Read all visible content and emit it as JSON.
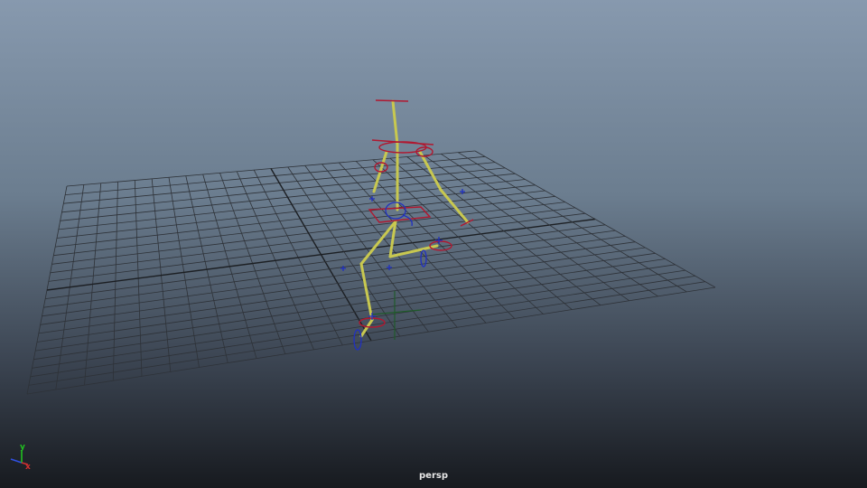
{
  "viewport": {
    "camera_name": "persp",
    "background_top": "#8799ae",
    "background_bottom": "#171a1f"
  },
  "axis_gizmo": {
    "x_label": "x",
    "y_label": "y",
    "x_color": "#d03030",
    "y_color": "#20c020",
    "z_color": "#3050e0"
  },
  "scene": {
    "grid_color": "#2e3238",
    "grid_axis_color": "#1c1f23",
    "bone_color": "#c8c850",
    "ik_control_color": "#b01830",
    "fk_control_color": "#2030c0",
    "pivot_color": "#1f5a2a"
  }
}
